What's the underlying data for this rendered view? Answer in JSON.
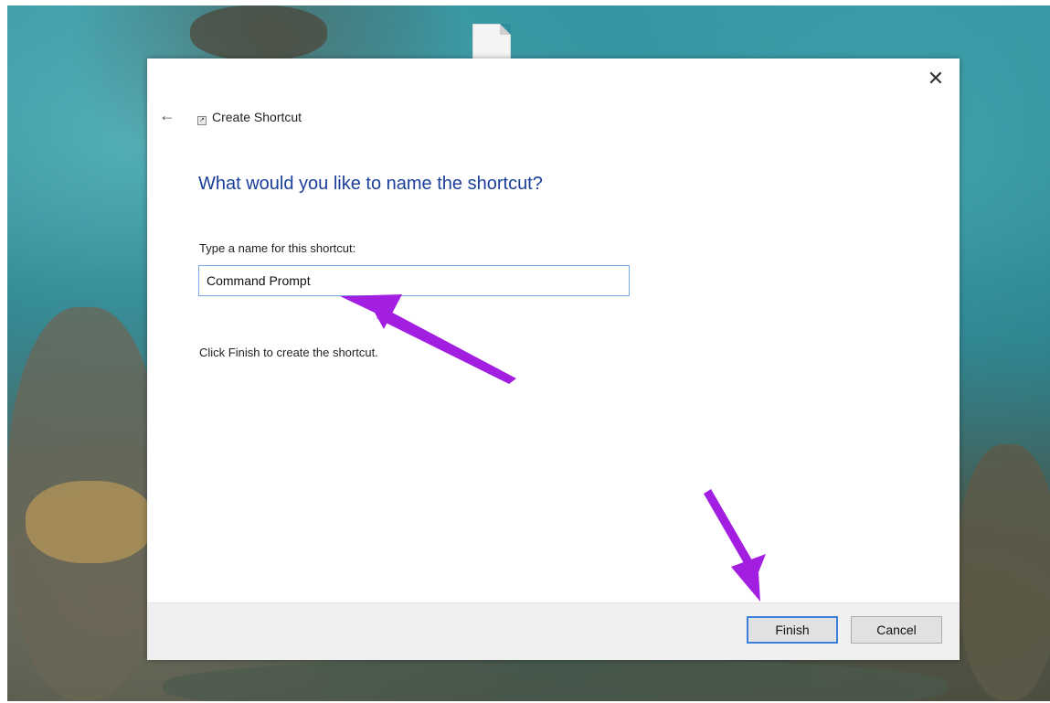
{
  "dialog": {
    "title": "Create Shortcut",
    "close_icon": "close-icon",
    "back_icon": "back-arrow-icon",
    "heading": "What would you like to name the shortcut?",
    "field_label": "Type a name for this shortcut:",
    "name_value": "Command Prompt",
    "hint": "Click Finish to create the shortcut.",
    "buttons": {
      "finish": "Finish",
      "cancel": "Cancel"
    }
  },
  "glyphs": {
    "close": "✕",
    "back": "←",
    "wizard": "↗"
  },
  "colors": {
    "heading": "#1b3f9a",
    "annotation_arrow": "#a21ee0",
    "focus_border": "#3c7fd8"
  }
}
